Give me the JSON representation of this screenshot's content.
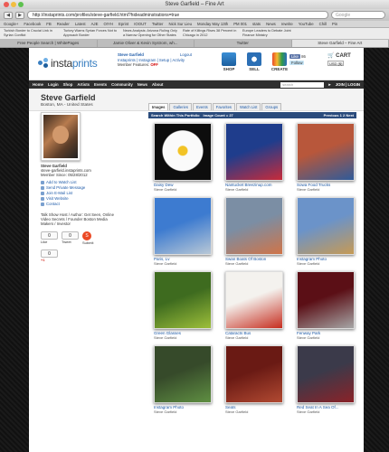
{
  "browser": {
    "window_title": "Steve Garfield – Fine Art",
    "url": "http://instaprints.com/profiles/steve-garfield.html?hideadminstrations=true",
    "search_placeholder": "Google",
    "back": "◀",
    "forward": "▶",
    "bookmarks": [
      "Google+",
      "Facebook",
      "FB",
      "Reader",
      "Latest",
      "AJE",
      "OIYH",
      "Eprint",
      "IOOUT",
      "Twitter",
      "Nick Sur Lieu",
      "Monday May 13th",
      "PM 001",
      "stats",
      "News",
      "rewrite",
      "YouTube",
      "Chill",
      "Pin"
    ],
    "news": [
      "Turkish Border to Crucial Link in Syrian Conflict",
      "Turkey Warns Syrian Forces Not to Approach Border",
      "News Analysis: Arizona Ruling Only a Narrow Opening for Other States",
      "Rate of Killings Rises 38 Percent in Chicago in 2012",
      "Europe Leaders to Debate Joint Finance Ministry"
    ],
    "tabs": [
      "Free People Search | WhitePages",
      "Jamie Oliver & Kevin Systrom, wh...",
      "Twitter",
      "Steve Garfield – Fine Art"
    ]
  },
  "site": {
    "logo_a": "insta",
    "logo_b": "prints",
    "user": {
      "name": "Steve Garfield",
      "links": "Instaprints | Instagram | Setup | Activity",
      "member_label": "Member Features:",
      "member_state": "OFF",
      "logout": "Logout"
    },
    "header_buttons": {
      "shop": "SHOP",
      "sell": "SELL",
      "create": "CREATE"
    },
    "social": {
      "like": "Like",
      "like_count": "86",
      "follow": "Follow"
    },
    "cart": "CART",
    "currency": "USD ($)",
    "nav": [
      "Home",
      "Login",
      "Shop",
      "Artists",
      "Events",
      "Community",
      "News",
      "About"
    ],
    "search_placeholder": "search",
    "join": "JOIN | LOGIN"
  },
  "profile": {
    "name": "Steve Garfield",
    "location": "Boston, MA - United States",
    "tabs": [
      "Images",
      "Galleries",
      "Events",
      "Favorites",
      "Watch List",
      "Groups"
    ],
    "artist_name": "Steve Garfield",
    "site": "steve-garfield.instaprints.com",
    "member_since": "Member Since: 05/28/2012",
    "links": [
      "Add to Watch List",
      "Send Private Message",
      "Join E-Mail List",
      "Visit Website",
      "Contact"
    ],
    "bio": "Talk Show Host / Author: Get Seen, Online Video Secrets / Founder Boston Media Makers / Investor",
    "share": {
      "fb_count": "0",
      "tw_count": "0",
      "gplus_count": "0",
      "like": "Like",
      "tweet": "Tweet",
      "submit": "Submit",
      "gplus": "+1"
    }
  },
  "results": {
    "search_label": "Search Within This Portfolio",
    "count": "Image Count = 27",
    "prev": "Previous",
    "page1": "1",
    "page2": "2",
    "next": "Next"
  },
  "images": [
    {
      "title": "Daisy Dew",
      "artist": "Steve Garfield",
      "bg": "#0d0d0d",
      "fg": "#f4f4f4"
    },
    {
      "title": "Nantucket Breezinup.com",
      "artist": "Steve Garfield",
      "bg": "#1f3d8c",
      "fg": "#c82b3a"
    },
    {
      "title": "Sowa Food Trucks",
      "artist": "Steve Garfield",
      "bg": "#b8573b",
      "fg": "#2f5b9a"
    },
    {
      "title": "Paris, Lv",
      "artist": "Steve Garfield",
      "bg": "#3d7bd0",
      "fg": "#b9c8d6"
    },
    {
      "title": "Swan Boats Of Boston",
      "artist": "Steve Garfield",
      "bg": "#7b8ea4",
      "fg": "#d07448"
    },
    {
      "title": "Instagram Photo",
      "artist": "Steve Garfield",
      "bg": "#6b93c9",
      "fg": "#c69a55"
    },
    {
      "title": "Green Glasses",
      "artist": "Steve Garfield",
      "bg": "#3e6b1f",
      "fg": "#9dbf3a"
    },
    {
      "title": "Cataracts Bus",
      "artist": "Steve Garfield",
      "bg": "#f4f2ee",
      "fg": "#c62d1f"
    },
    {
      "title": "Fenway Park",
      "artist": "Steve Garfield",
      "bg": "#5b0f16",
      "fg": "#a6a6a6"
    },
    {
      "title": "Instagram Photo",
      "artist": "Steve Garfield",
      "bg": "#364a2a",
      "fg": "#5f8f42"
    },
    {
      "title": "Seats",
      "artist": "Steve Garfield",
      "bg": "#6a1a14",
      "fg": "#b24a32"
    },
    {
      "title": "Red Seat In A Sea Of...",
      "artist": "Steve Garfield",
      "bg": "#3b3a4a",
      "fg": "#8b2228"
    }
  ],
  "colors": {
    "accent": "#3a7fc1",
    "nav_bar": "#2f2f2f",
    "results_bar": "#2a4b7c",
    "link": "#1d5aa8"
  }
}
